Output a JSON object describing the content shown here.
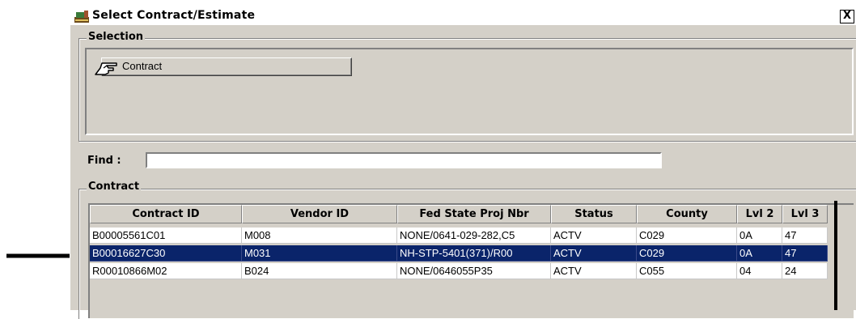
{
  "window": {
    "title": "Select Contract/Estimate",
    "close_label": "X"
  },
  "selection": {
    "group_label": "Selection",
    "button_label": "Contract"
  },
  "find": {
    "label": "Find :",
    "value": ""
  },
  "contract_group": {
    "label": "Contract",
    "columns": [
      "Contract ID",
      "Vendor ID",
      "Fed State Proj Nbr",
      "Status",
      "County",
      "Lvl 2",
      "Lvl 3"
    ],
    "rows": [
      [
        "B00005561C01",
        "M008",
        "NONE/0641-029-282,C5",
        "ACTV",
        "C029",
        "0A",
        "47"
      ],
      [
        "B00016627C30",
        "M031",
        "NH-STP-5401(371)/R00",
        "ACTV",
        "C029",
        "0A",
        "47"
      ],
      [
        "R00010866M02",
        "B024",
        "NONE/0646055P35",
        "ACTV",
        "C055",
        "04",
        "24"
      ]
    ],
    "selected_row": 1
  },
  "colors": {
    "selection_bg": "#0a246a",
    "window_bg": "#d4d0c8"
  }
}
